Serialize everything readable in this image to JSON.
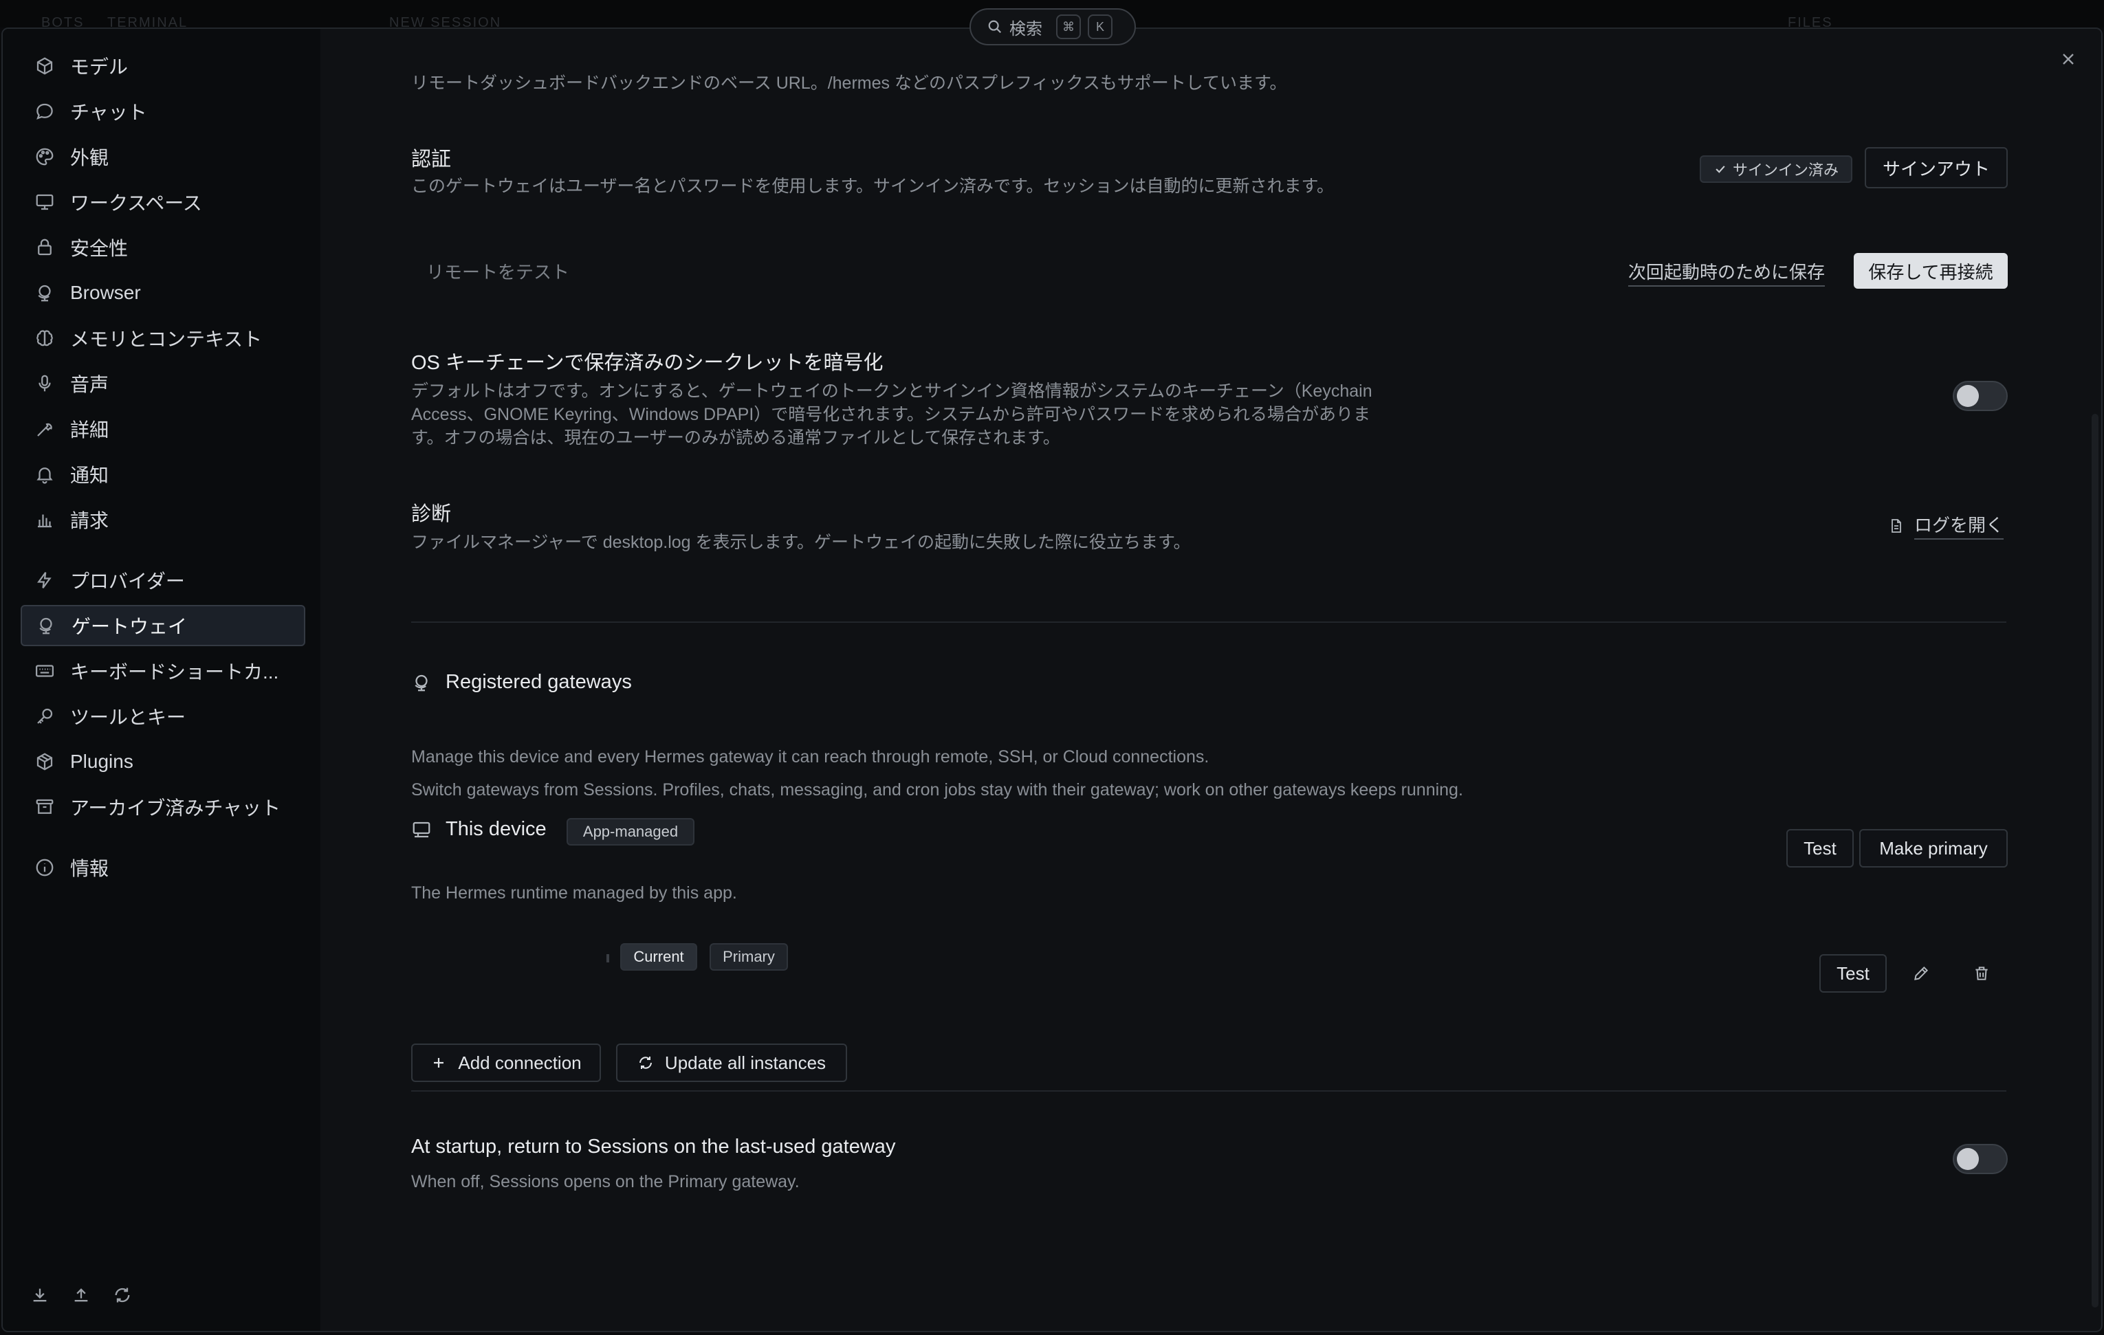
{
  "topbar": {
    "ghost_tabs": [
      "BOTS",
      "TERMINAL",
      "NEW SESSION",
      "FILES"
    ],
    "search_label": "検索",
    "search_key_mod": "⌘",
    "search_key": "K"
  },
  "sidebar": {
    "items": [
      {
        "label": "モデル",
        "icon": "cube-icon"
      },
      {
        "label": "チャット",
        "icon": "chat-bubble-icon"
      },
      {
        "label": "外観",
        "icon": "palette-icon"
      },
      {
        "label": "ワークスペース",
        "icon": "monitor-icon"
      },
      {
        "label": "安全性",
        "icon": "lock-icon"
      },
      {
        "label": "Browser",
        "icon": "globe-stand-icon"
      },
      {
        "label": "メモリとコンテキスト",
        "icon": "brain-icon"
      },
      {
        "label": "音声",
        "icon": "microphone-icon"
      },
      {
        "label": "詳細",
        "icon": "wrench-icon"
      },
      {
        "label": "通知",
        "icon": "bell-icon"
      },
      {
        "label": "請求",
        "icon": "bar-chart-icon"
      },
      {
        "label": "プロバイダー",
        "icon": "bolt-icon"
      },
      {
        "label": "ゲートウェイ",
        "icon": "globe-stand-icon",
        "active": true
      },
      {
        "label": "キーボードショートカ...",
        "icon": "keyboard-icon"
      },
      {
        "label": "ツールとキー",
        "icon": "key-icon"
      },
      {
        "label": "Plugins",
        "icon": "package-icon"
      },
      {
        "label": "アーカイブ済みチャット",
        "icon": "archive-icon"
      },
      {
        "label": "情報",
        "icon": "info-icon"
      }
    ],
    "footer_icons": [
      "download-icon",
      "upload-icon",
      "refresh-icon"
    ]
  },
  "remote": {
    "url_desc": "リモートダッシュボードバックエンドのベース URL。/hermes などのパスプレフィックスもサポートしています。"
  },
  "auth": {
    "title": "認証",
    "desc": "このゲートウェイはユーザー名とパスワードを使用します。サインイン済みです。セッションは自動的に更新されます。",
    "signed_in_badge": "サインイン済み",
    "sign_out": "サインアウト"
  },
  "test_remote": {
    "label": "リモートをテスト",
    "save_next": "次回起動時のために保存",
    "save_reconnect": "保存して再接続"
  },
  "keychain": {
    "title": "OS キーチェーンで保存済みのシークレットを暗号化",
    "desc_lines": [
      "デフォルトはオフです。オンにすると、ゲートウェイのトークンとサインイン資格情報がシステムのキーチェーン（Keychain",
      "Access、GNOME Keyring、Windows DPAPI）で暗号化されます。システムから許可やパスワードを求められる場合がありま",
      "す。オフの場合は、現在のユーザーのみが読める通常ファイルとして保存されます。"
    ],
    "enabled": false
  },
  "diagnostics": {
    "title": "診断",
    "desc": "ファイルマネージャーで desktop.log を表示します。ゲートウェイの起動に失敗した際に役立ちます。",
    "open_logs": "ログを開く"
  },
  "gateways": {
    "title": "Registered gateways",
    "desc1": "Manage this device and every Hermes gateway it can reach through remote, SSH, or Cloud connections.",
    "desc2": "Switch gateways from Sessions. Profiles, chats, messaging, and cron jobs stay with their gateway; work on other gateways keeps running.",
    "device": {
      "name": "This device",
      "badge": "App-managed",
      "desc": "The Hermes runtime managed by this app.",
      "test": "Test",
      "make_primary": "Make primary"
    },
    "connection": {
      "badges": [
        "Current",
        "Primary"
      ],
      "test": "Test"
    },
    "add_connection": "Add connection",
    "update_all": "Update all instances"
  },
  "startup": {
    "title": "At startup, return to Sessions on the last-used gateway",
    "desc": "When off, Sessions opens on the Primary gateway.",
    "enabled": false
  }
}
